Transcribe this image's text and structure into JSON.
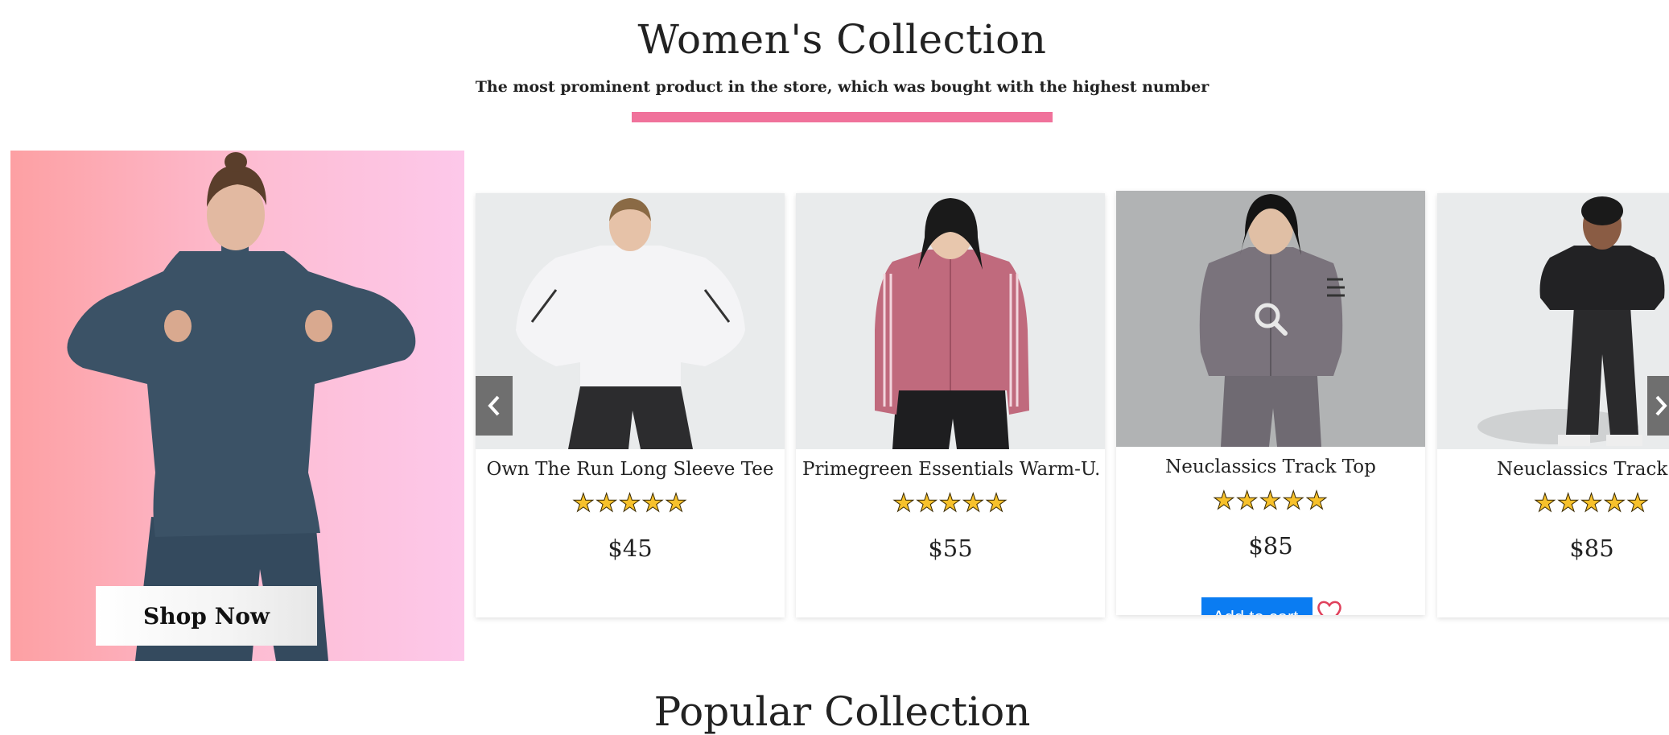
{
  "section": {
    "title": "Women's Collection",
    "subtitle": "The most prominent product in the store, which was bought with the highest number",
    "accent_color": "#f0729b"
  },
  "promo": {
    "button_label": "Shop Now"
  },
  "products": [
    {
      "name": "Own The Run Long Sleeve Tee",
      "price": "$45",
      "rating": 5,
      "stars": "★★★★★"
    },
    {
      "name": "Primegreen Essentials Warm-U...",
      "price": "$55",
      "rating": 5,
      "stars": "★★★★★"
    },
    {
      "name": "Neuclassics Track Top",
      "price": "$85",
      "rating": 5,
      "stars": "★★★★★",
      "add_label": "Add to cart",
      "hovered": true
    },
    {
      "name": "Neuclassics Track Top",
      "price": "$85",
      "rating": 5,
      "stars": "★★★★★"
    }
  ],
  "carousel": {
    "prev_icon": "chevron-left-icon",
    "next_icon": "chevron-right-icon"
  },
  "next_section": {
    "title": "Popular Collection"
  }
}
